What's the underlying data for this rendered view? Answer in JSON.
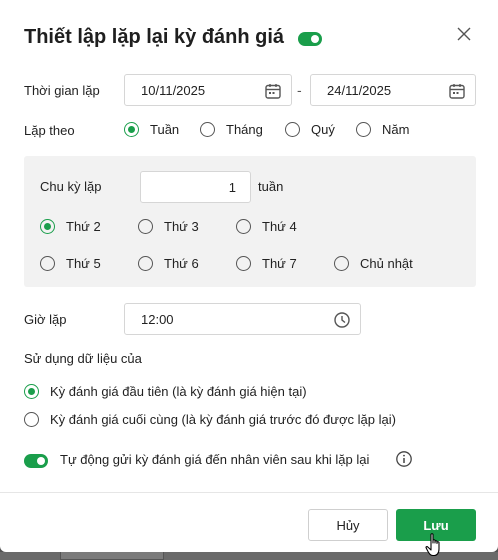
{
  "dialog": {
    "title": "Thiết lập lặp lại kỳ đánh giá",
    "enabled": true
  },
  "repeat_period": {
    "label": "Thời gian lặp",
    "start": "10/11/2025",
    "separator": "-",
    "end": "24/11/2025"
  },
  "repeat_by": {
    "label": "Lặp theo",
    "options": [
      "Tuần",
      "Tháng",
      "Quý",
      "Năm"
    ],
    "selected": "Tuần"
  },
  "cycle": {
    "label": "Chu kỳ lặp",
    "value": "1",
    "unit": "tuần",
    "days": [
      "Thứ 2",
      "Thứ 3",
      "Thứ 4",
      "Thứ 5",
      "Thứ 6",
      "Thứ 7",
      "Chủ nhật"
    ],
    "selected_day": "Thứ 2"
  },
  "repeat_time": {
    "label": "Giờ lặp",
    "value": "12:00"
  },
  "data_source": {
    "label": "Sử dụng dữ liệu của",
    "options": [
      "Kỳ đánh giá đầu tiên (là kỳ đánh giá hiện tại)",
      "Kỳ đánh giá cuối cùng (là kỳ đánh giá trước đó được lặp lại)"
    ],
    "selected_index": 0
  },
  "auto_send": {
    "enabled": true,
    "label": "Tự động gửi kỳ đánh giá đến nhân viên sau khi lặp lại"
  },
  "footer": {
    "cancel_label": "Hủy",
    "save_label": "Lưu"
  },
  "colors": {
    "accent": "#1a9e4b"
  }
}
